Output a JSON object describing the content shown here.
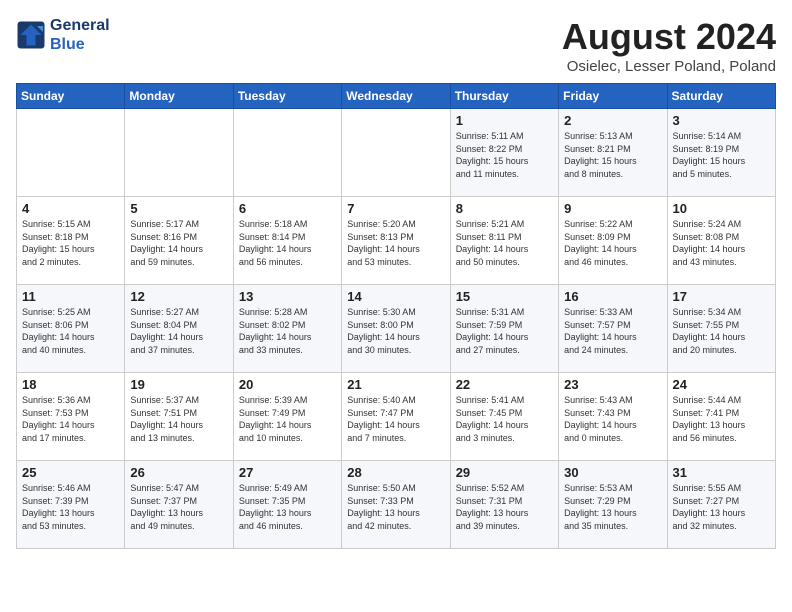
{
  "header": {
    "logo_line1": "General",
    "logo_line2": "Blue",
    "month_title": "August 2024",
    "location": "Osielec, Lesser Poland, Poland"
  },
  "weekdays": [
    "Sunday",
    "Monday",
    "Tuesday",
    "Wednesday",
    "Thursday",
    "Friday",
    "Saturday"
  ],
  "weeks": [
    [
      {
        "day": "",
        "info": ""
      },
      {
        "day": "",
        "info": ""
      },
      {
        "day": "",
        "info": ""
      },
      {
        "day": "",
        "info": ""
      },
      {
        "day": "1",
        "info": "Sunrise: 5:11 AM\nSunset: 8:22 PM\nDaylight: 15 hours\nand 11 minutes."
      },
      {
        "day": "2",
        "info": "Sunrise: 5:13 AM\nSunset: 8:21 PM\nDaylight: 15 hours\nand 8 minutes."
      },
      {
        "day": "3",
        "info": "Sunrise: 5:14 AM\nSunset: 8:19 PM\nDaylight: 15 hours\nand 5 minutes."
      }
    ],
    [
      {
        "day": "4",
        "info": "Sunrise: 5:15 AM\nSunset: 8:18 PM\nDaylight: 15 hours\nand 2 minutes."
      },
      {
        "day": "5",
        "info": "Sunrise: 5:17 AM\nSunset: 8:16 PM\nDaylight: 14 hours\nand 59 minutes."
      },
      {
        "day": "6",
        "info": "Sunrise: 5:18 AM\nSunset: 8:14 PM\nDaylight: 14 hours\nand 56 minutes."
      },
      {
        "day": "7",
        "info": "Sunrise: 5:20 AM\nSunset: 8:13 PM\nDaylight: 14 hours\nand 53 minutes."
      },
      {
        "day": "8",
        "info": "Sunrise: 5:21 AM\nSunset: 8:11 PM\nDaylight: 14 hours\nand 50 minutes."
      },
      {
        "day": "9",
        "info": "Sunrise: 5:22 AM\nSunset: 8:09 PM\nDaylight: 14 hours\nand 46 minutes."
      },
      {
        "day": "10",
        "info": "Sunrise: 5:24 AM\nSunset: 8:08 PM\nDaylight: 14 hours\nand 43 minutes."
      }
    ],
    [
      {
        "day": "11",
        "info": "Sunrise: 5:25 AM\nSunset: 8:06 PM\nDaylight: 14 hours\nand 40 minutes."
      },
      {
        "day": "12",
        "info": "Sunrise: 5:27 AM\nSunset: 8:04 PM\nDaylight: 14 hours\nand 37 minutes."
      },
      {
        "day": "13",
        "info": "Sunrise: 5:28 AM\nSunset: 8:02 PM\nDaylight: 14 hours\nand 33 minutes."
      },
      {
        "day": "14",
        "info": "Sunrise: 5:30 AM\nSunset: 8:00 PM\nDaylight: 14 hours\nand 30 minutes."
      },
      {
        "day": "15",
        "info": "Sunrise: 5:31 AM\nSunset: 7:59 PM\nDaylight: 14 hours\nand 27 minutes."
      },
      {
        "day": "16",
        "info": "Sunrise: 5:33 AM\nSunset: 7:57 PM\nDaylight: 14 hours\nand 24 minutes."
      },
      {
        "day": "17",
        "info": "Sunrise: 5:34 AM\nSunset: 7:55 PM\nDaylight: 14 hours\nand 20 minutes."
      }
    ],
    [
      {
        "day": "18",
        "info": "Sunrise: 5:36 AM\nSunset: 7:53 PM\nDaylight: 14 hours\nand 17 minutes."
      },
      {
        "day": "19",
        "info": "Sunrise: 5:37 AM\nSunset: 7:51 PM\nDaylight: 14 hours\nand 13 minutes."
      },
      {
        "day": "20",
        "info": "Sunrise: 5:39 AM\nSunset: 7:49 PM\nDaylight: 14 hours\nand 10 minutes."
      },
      {
        "day": "21",
        "info": "Sunrise: 5:40 AM\nSunset: 7:47 PM\nDaylight: 14 hours\nand 7 minutes."
      },
      {
        "day": "22",
        "info": "Sunrise: 5:41 AM\nSunset: 7:45 PM\nDaylight: 14 hours\nand 3 minutes."
      },
      {
        "day": "23",
        "info": "Sunrise: 5:43 AM\nSunset: 7:43 PM\nDaylight: 14 hours\nand 0 minutes."
      },
      {
        "day": "24",
        "info": "Sunrise: 5:44 AM\nSunset: 7:41 PM\nDaylight: 13 hours\nand 56 minutes."
      }
    ],
    [
      {
        "day": "25",
        "info": "Sunrise: 5:46 AM\nSunset: 7:39 PM\nDaylight: 13 hours\nand 53 minutes."
      },
      {
        "day": "26",
        "info": "Sunrise: 5:47 AM\nSunset: 7:37 PM\nDaylight: 13 hours\nand 49 minutes."
      },
      {
        "day": "27",
        "info": "Sunrise: 5:49 AM\nSunset: 7:35 PM\nDaylight: 13 hours\nand 46 minutes."
      },
      {
        "day": "28",
        "info": "Sunrise: 5:50 AM\nSunset: 7:33 PM\nDaylight: 13 hours\nand 42 minutes."
      },
      {
        "day": "29",
        "info": "Sunrise: 5:52 AM\nSunset: 7:31 PM\nDaylight: 13 hours\nand 39 minutes."
      },
      {
        "day": "30",
        "info": "Sunrise: 5:53 AM\nSunset: 7:29 PM\nDaylight: 13 hours\nand 35 minutes."
      },
      {
        "day": "31",
        "info": "Sunrise: 5:55 AM\nSunset: 7:27 PM\nDaylight: 13 hours\nand 32 minutes."
      }
    ]
  ]
}
